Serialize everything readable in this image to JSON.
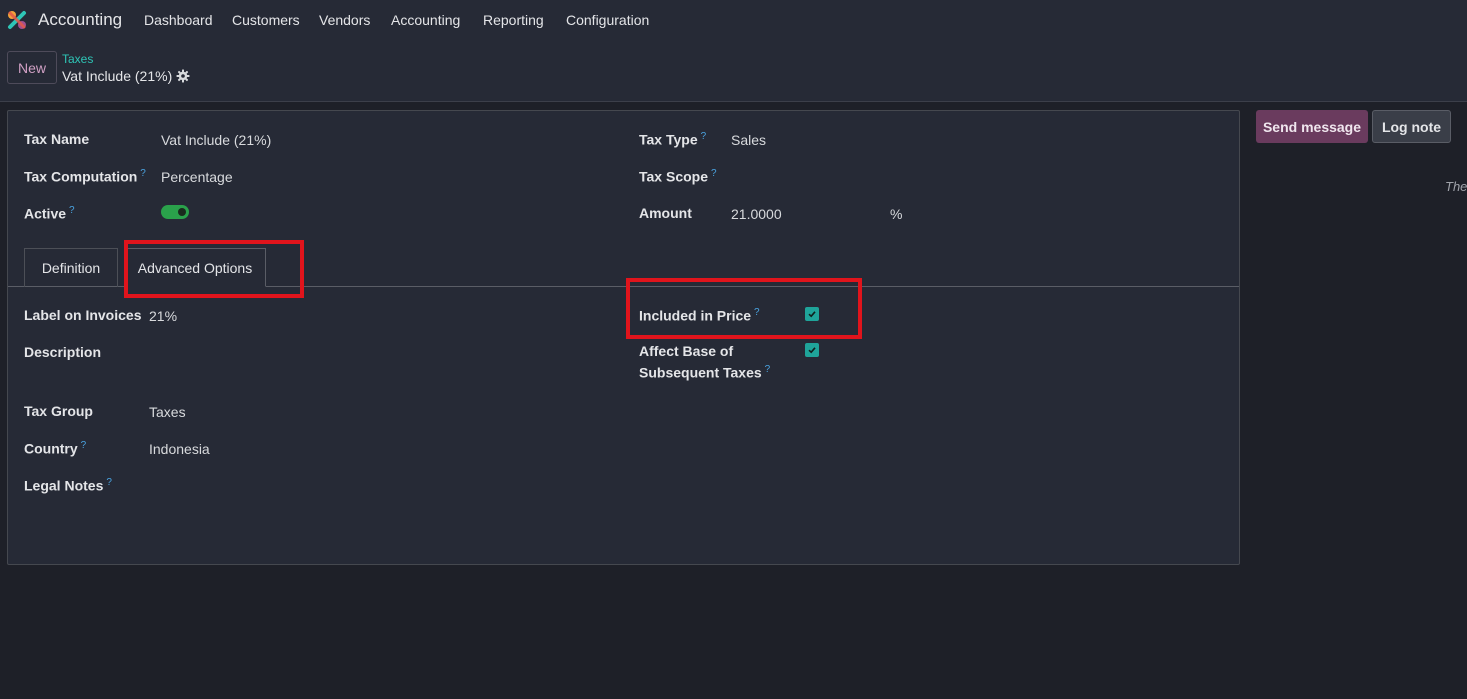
{
  "navbar": {
    "app_name": "Accounting",
    "menu": [
      "Dashboard",
      "Customers",
      "Vendors",
      "Accounting",
      "Reporting",
      "Configuration"
    ]
  },
  "controlbar": {
    "new_label": "New",
    "breadcrumb_parent": "Taxes",
    "breadcrumb_current": "Vat Include (21%)"
  },
  "form": {
    "tax_name_label": "Tax Name",
    "tax_name_value": "Vat Include (21%)",
    "tax_computation_label": "Tax Computation",
    "tax_computation_value": "Percentage",
    "active_label": "Active",
    "active_value": true,
    "tax_type_label": "Tax Type",
    "tax_type_value": "Sales",
    "tax_scope_label": "Tax Scope",
    "tax_scope_value": "",
    "amount_label": "Amount",
    "amount_value": "21.0000",
    "amount_unit": "%",
    "hint_mark": "?"
  },
  "tabs": [
    "Definition",
    "Advanced Options"
  ],
  "advanced": {
    "label_on_invoices_label": "Label on Invoices",
    "label_on_invoices_value": "21%",
    "description_label": "Description",
    "tax_group_label": "Tax Group",
    "tax_group_value": "Taxes",
    "country_label": "Country",
    "country_value": "Indonesia",
    "legal_notes_label": "Legal Notes",
    "included_in_price_label": "Included in Price",
    "included_in_price_value": true,
    "affect_base_label_line1": "Affect Base of",
    "affect_base_label_line2": "Subsequent Taxes",
    "affect_base_value": true
  },
  "chatter": {
    "send_message_label": "Send message",
    "log_note_label": "Log note",
    "truncated_text": "The"
  },
  "colors": {
    "accent_teal": "#2ec5b6",
    "toggle_green": "#2aa14b",
    "checkbox_teal": "#1fa49a",
    "highlight_red": "#e0141c",
    "send_button": "#6a3b5e"
  }
}
